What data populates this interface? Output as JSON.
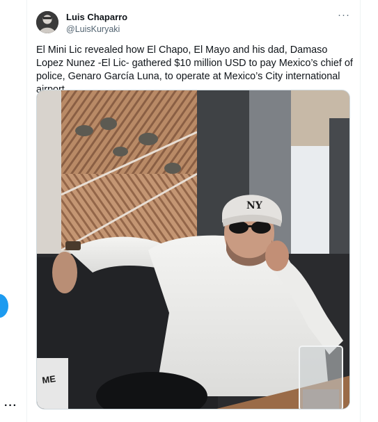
{
  "tweet": {
    "author": {
      "display_name": "Luis Chaparro",
      "handle": "@LuisKuryaki",
      "avatar_icon": "avatar-photo-icon"
    },
    "more_icon": "more-options-icon",
    "more_label": "···",
    "text": "El Mini Lic revealed how El Chapo, El Mayo and his dad, Damaso Lopez Nunez -El Lic- gathered $10 million USD to pay Mexico’s chief of police, Genaro García Luna, to operate at Mexico’s City international airport.",
    "media": {
      "cap_logo": "NY"
    }
  },
  "left_rail": {
    "compose_icon": "compose-button-icon",
    "more_label": "···"
  },
  "colors": {
    "accent": "#1d9bf0",
    "text_primary": "#0f1419",
    "text_secondary": "#536471",
    "border": "#cfd9de"
  }
}
